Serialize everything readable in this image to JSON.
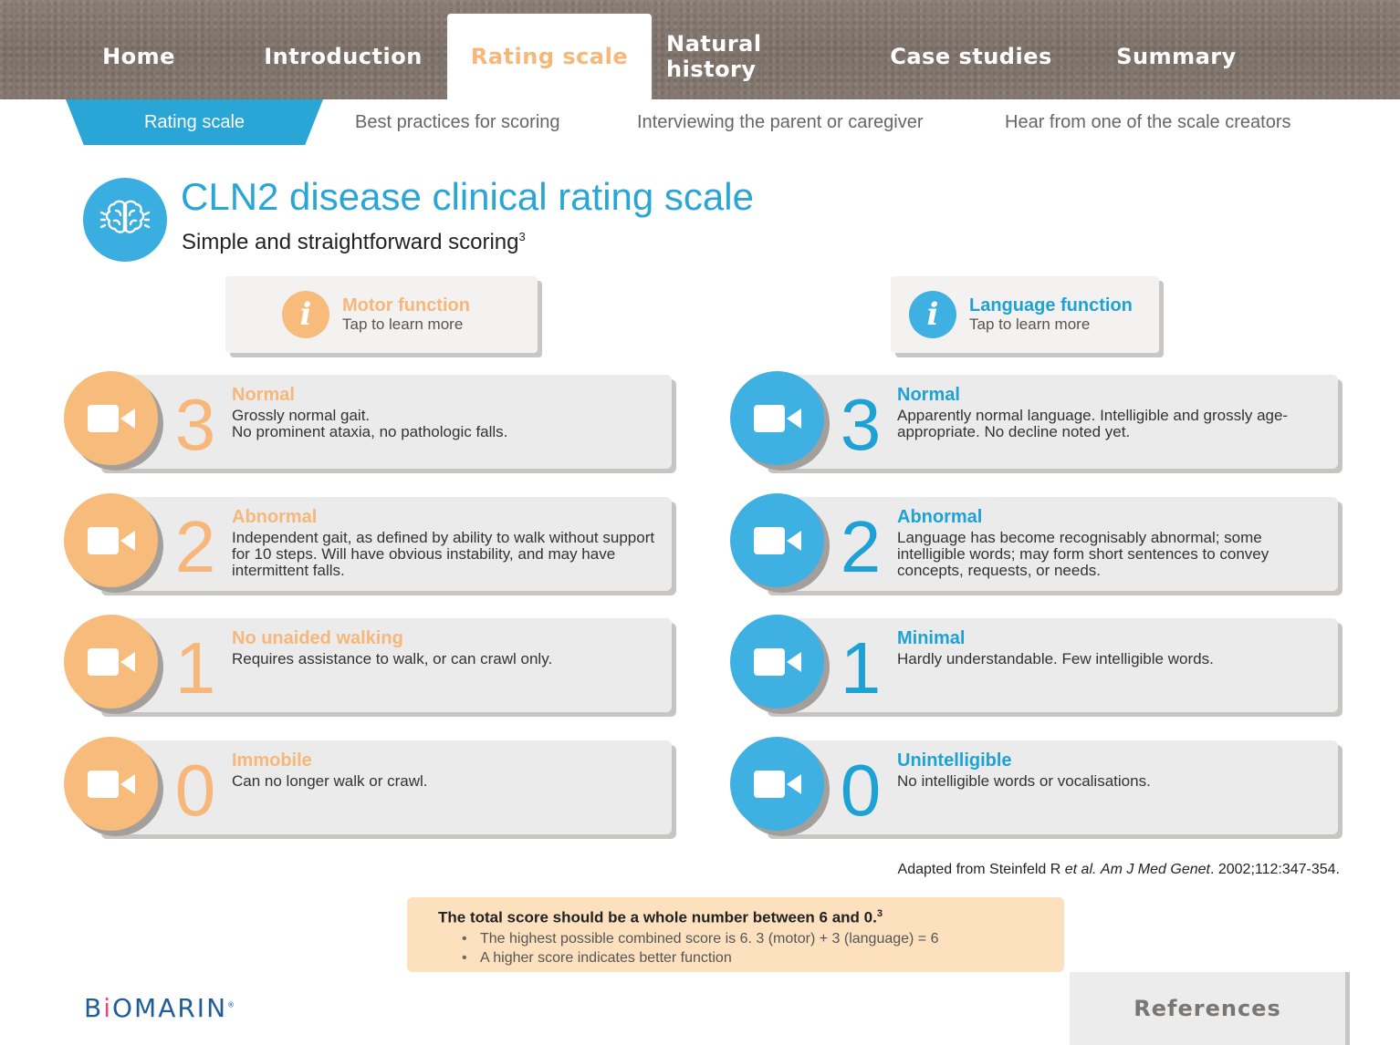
{
  "top_nav": {
    "items": [
      {
        "label": "Home"
      },
      {
        "label": "Introduction"
      },
      {
        "label": "Rating scale",
        "active": true
      },
      {
        "label": "Natural history"
      },
      {
        "label": "Case studies"
      },
      {
        "label": "Summary"
      }
    ]
  },
  "sub_nav": {
    "items": [
      {
        "label": "Rating scale",
        "active": true
      },
      {
        "label": "Best practices for scoring"
      },
      {
        "label": "Interviewing the parent or caregiver"
      },
      {
        "label": "Hear from one of the scale creators"
      }
    ]
  },
  "header": {
    "icon": "brain-icon",
    "title": "CLN2 disease clinical rating scale",
    "subtitle": "Simple and straightforward scoring",
    "subtitle_ref": "3"
  },
  "motor": {
    "info_title": "Motor function",
    "info_sub": "Tap to learn more",
    "color": "#f7b77a",
    "items": [
      {
        "score": "3",
        "title": "Normal",
        "desc": "Grossly normal gait.\nNo prominent ataxia, no pathologic falls."
      },
      {
        "score": "2",
        "title": "Abnormal",
        "desc": "Independent gait, as defined by ability to walk without support for 10 steps. Will have obvious instability, and may have intermittent falls."
      },
      {
        "score": "1",
        "title": "No unaided walking",
        "desc": "Requires assistance to walk, or can crawl only."
      },
      {
        "score": "0",
        "title": "Immobile",
        "desc": "Can no longer walk or crawl."
      }
    ]
  },
  "language": {
    "info_title": "Language function",
    "info_sub": "Tap to learn more",
    "color": "#1ea2d6",
    "items": [
      {
        "score": "3",
        "title": "Normal",
        "desc": "Apparently normal language. Intelligible and grossly age-appropriate. No decline noted yet."
      },
      {
        "score": "2",
        "title": "Abnormal",
        "desc": "Language has become recognisably abnormal; some intelligible words; may form short sentences to convey concepts, requests, or needs."
      },
      {
        "score": "1",
        "title": "Minimal",
        "desc": "Hardly understandable. Few intelligible words."
      },
      {
        "score": "0",
        "title": "Unintelligible",
        "desc": "No intelligible words or vocalisations."
      }
    ]
  },
  "citation": {
    "prefix": "Adapted from Steinfeld R ",
    "etal": "et al.",
    "journal": "Am J Med Genet",
    "suffix": ". 2002;112:347-354."
  },
  "note": {
    "heading": "The total score should be a whole number between 6 and 0.",
    "heading_ref": "3",
    "bullets": [
      "The highest possible combined score is 6. 3 (motor) + 3 (language) = 6",
      "A higher score indicates better function"
    ]
  },
  "logo": {
    "part1": "B",
    "dot": "i",
    "part2": "OMARIN",
    "mark": "®"
  },
  "references_button": "References"
}
